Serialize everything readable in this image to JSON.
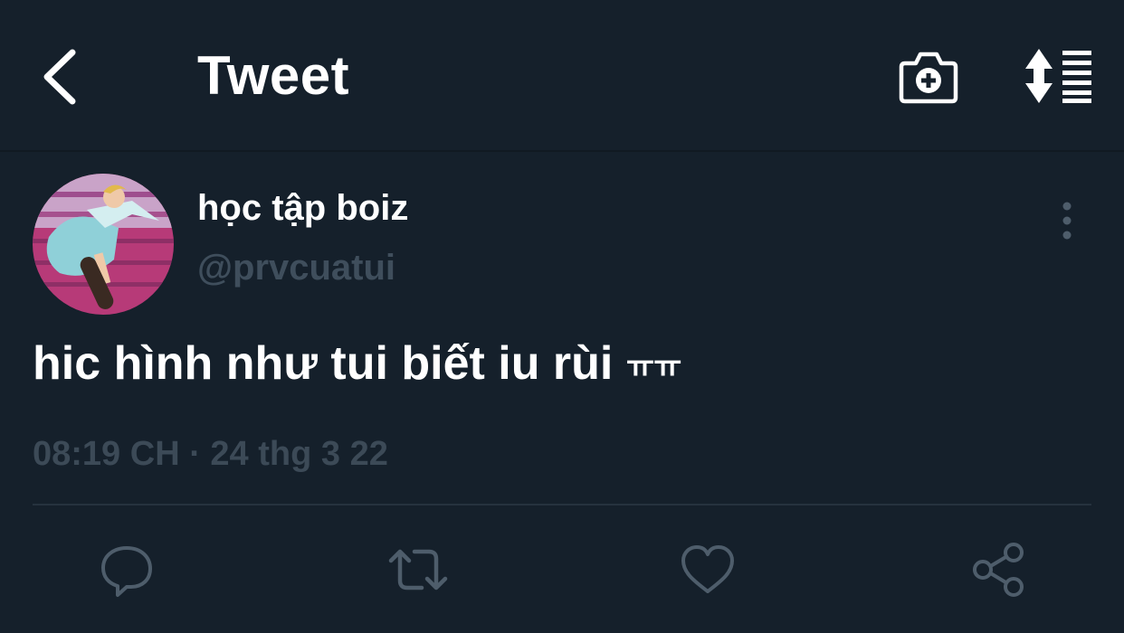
{
  "header": {
    "title": "Tweet",
    "icons": [
      "back-arrow-icon",
      "camera-add-icon",
      "sort-icon"
    ]
  },
  "tweet": {
    "author_name": "học tập boiz",
    "author_handle": "@prvcuatui",
    "text": "hic hình như tui biết iu rùi",
    "emoticon": "ㅠㅠ",
    "time": "08:19 CH",
    "separator": "·",
    "date": "24 thg 3 22"
  },
  "actions": {
    "icons": [
      "reply-icon",
      "retweet-icon",
      "like-icon",
      "share-icon"
    ]
  },
  "colors": {
    "background": "#15202b",
    "text": "#ffffff",
    "muted": "#3f4e5c",
    "icon_muted": "#4e5d6b",
    "divider": "#26323e"
  }
}
